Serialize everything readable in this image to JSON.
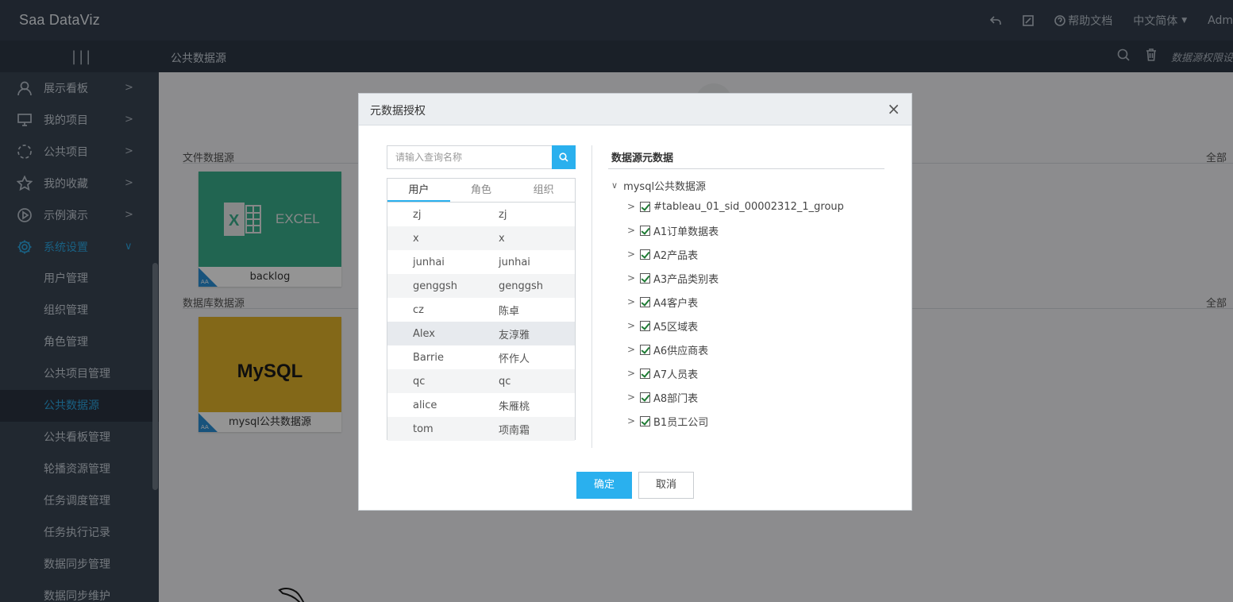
{
  "app": {
    "logo": "Saa DataViz"
  },
  "topbar": {
    "help": "帮助文档",
    "language": "中文简体",
    "user": "Adm"
  },
  "header": {
    "hamburger": "|||",
    "breadcrumb": "公共数据源",
    "permission_hint": "数据源权限设"
  },
  "sidebar": {
    "items": [
      {
        "label": "展示看板",
        "icon": "user-icon"
      },
      {
        "label": "我的项目",
        "icon": "monitor-icon"
      },
      {
        "label": "公共项目",
        "icon": "loading-circle-icon"
      },
      {
        "label": "我的收藏",
        "icon": "star-icon"
      },
      {
        "label": "示例演示",
        "icon": "play-icon"
      },
      {
        "label": "系统设置",
        "icon": "gear-icon"
      }
    ],
    "sub_items": [
      "用户管理",
      "组织管理",
      "角色管理",
      "公共项目管理",
      "公共数据源",
      "公共看板管理",
      "轮播资源管理",
      "任务调度管理",
      "任务执行记录",
      "数据同步管理",
      "数据同步维护"
    ]
  },
  "main": {
    "file_section": "文件数据源",
    "db_section": "数据库数据源",
    "all_label": "全部",
    "file_card": {
      "name": "backlog",
      "thumb_text": "EXCEL",
      "color": "#3aae8c"
    },
    "db_card": {
      "name": "mysql公共数据源",
      "thumb_text": "MySQL",
      "color": "#e2b32a"
    },
    "corner_text": "AA"
  },
  "dialog": {
    "title": "元数据授权",
    "close": "×",
    "search_placeholder": "请输入查询名称",
    "tabs": [
      "用户",
      "角色",
      "组织"
    ],
    "users": [
      {
        "account": "zj",
        "name": "zj"
      },
      {
        "account": "x",
        "name": "x"
      },
      {
        "account": "junhai",
        "name": "junhai"
      },
      {
        "account": "genggsh",
        "name": "genggsh"
      },
      {
        "account": "cz",
        "name": "陈卓"
      },
      {
        "account": "Alex",
        "name": "友淳雅"
      },
      {
        "account": "Barrie",
        "name": "怀作人"
      },
      {
        "account": "qc",
        "name": "qc"
      },
      {
        "account": "alice",
        "name": "朱雁桃"
      },
      {
        "account": "tom",
        "name": "项南霜"
      }
    ],
    "meta_title": "数据源元数据",
    "tree_root": "mysql公共数据源",
    "tree_items": [
      "#tableau_01_sid_00002312_1_group",
      "A1订单数据表",
      "A2产品表",
      "A3产品类别表",
      "A4客户表",
      "A5区域表",
      "A6供应商表",
      "A7人员表",
      "A8部门表",
      "B1员工公司"
    ],
    "ok": "确定",
    "cancel": "取消"
  },
  "colors": {
    "accent": "#2ab0ee",
    "sidebar_bg": "#3a4554",
    "topbar_bg": "#353f4e"
  }
}
